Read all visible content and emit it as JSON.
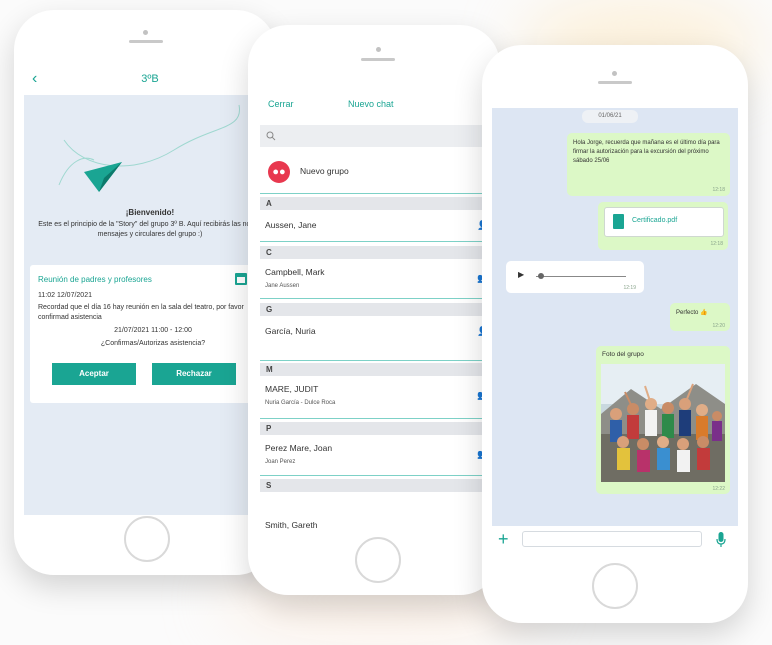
{
  "phone1": {
    "header": {
      "back_icon": "chevron-left-icon",
      "title": "3ºB"
    },
    "welcome": {
      "title": "¡Bienvenido!",
      "body": "Este es el principio de la \"Story\" del grupo 3º B. Aquí recibirás las notas, mensajes y circulares del grupo :)"
    },
    "event": {
      "title": "Reunión de padres y profesores",
      "date": "11:02 12/07/2021",
      "body": "Recordad que el día 16 hay reunión en la sala del teatro, por favor confirmad asistencia",
      "schedule": "21/07/2021 11:00 - 12:00",
      "question": "¿Confirmas/Autorizas asistencia?",
      "accept_label": "Aceptar",
      "reject_label": "Rechazar",
      "calendar_icon": "calendar-icon"
    }
  },
  "phone2": {
    "header": {
      "cancel_label": "Cerrar",
      "title": "Nuevo chat"
    },
    "search": {
      "icon": "search-icon",
      "placeholder": ""
    },
    "new_group_label": "Nuevo grupo",
    "contacts": [
      {
        "letter": "A",
        "name": "Aussen, Jane",
        "sub": "",
        "icon": "person-icon"
      },
      {
        "letter": "C",
        "name": "Campbell, Mark",
        "sub": "Jane Aussen",
        "icon": "group-icon"
      },
      {
        "letter": "G",
        "name": "García, Nuria",
        "sub": "",
        "icon": "person-icon"
      },
      {
        "letter": "M",
        "name": "MARE, JUDIT",
        "sub": "Nuria García - Dulce Roca",
        "icon": "group-icon"
      },
      {
        "letter": "P",
        "name": "Perez Mare, Joan",
        "sub": "Joan Perez",
        "icon": "group-icon"
      },
      {
        "letter": "S",
        "name": "Smith, Gareth",
        "sub": "",
        "icon": "person-icon"
      }
    ]
  },
  "phone3": {
    "date_chip": "01/06/21",
    "messages": {
      "m1": {
        "text": "Hola Jorge, recuerda que mañana es el último día para firmar la autorización para la excursión del próximo sábado 25/06",
        "time": "12:18"
      },
      "m2": {
        "file": "Certificado.pdf",
        "time": "12:18"
      },
      "m3": {
        "time": "12:19"
      },
      "m4": {
        "text": "Perfecto 👍",
        "time": "12:20"
      },
      "m5": {
        "caption": "Foto del grupo",
        "time": "12:22"
      }
    },
    "input": {
      "placeholder": "",
      "plus_icon": "plus-icon",
      "mic_icon": "microphone-icon"
    }
  },
  "colors": {
    "accent": "#1aa593",
    "chat_bg": "#dde6f3",
    "bubble_out": "#dcf8c6",
    "red": "#e8384f"
  }
}
